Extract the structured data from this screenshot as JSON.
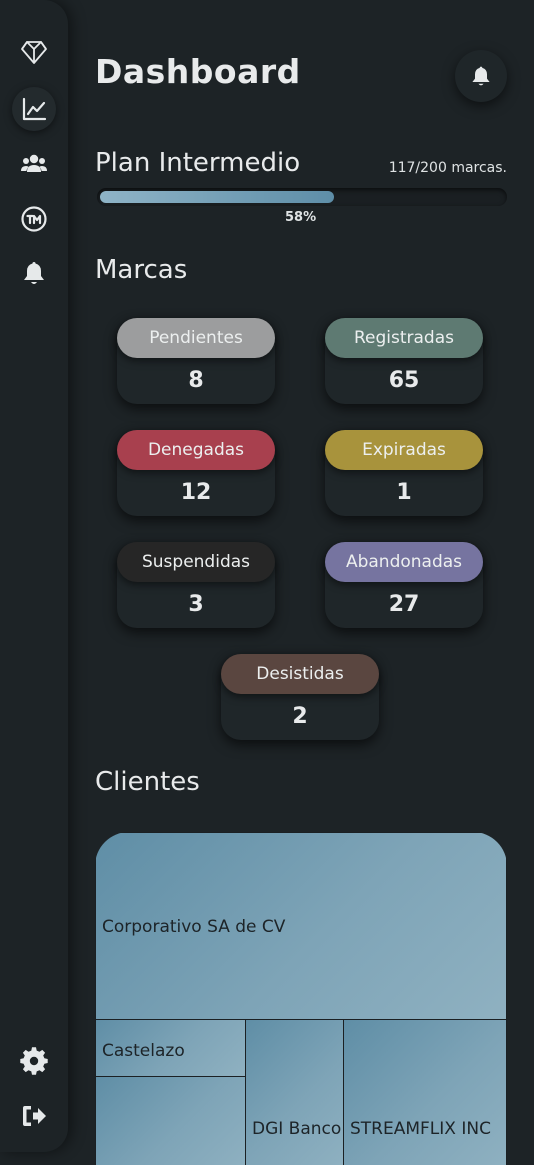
{
  "sidebar": {
    "items": [
      {
        "icon": "diamond-logo-icon"
      },
      {
        "icon": "chart-line-icon",
        "active": true
      },
      {
        "icon": "users-icon"
      },
      {
        "icon": "trademark-icon"
      },
      {
        "icon": "bell-icon"
      }
    ],
    "bottom": [
      {
        "icon": "gear-icon"
      },
      {
        "icon": "logout-icon"
      }
    ]
  },
  "header": {
    "title": "Dashboard",
    "bell_icon": "bell-icon"
  },
  "plan": {
    "name": "Plan Intermedio",
    "count": "117/200 marcas.",
    "progress": 0.58,
    "percent_label": "58%"
  },
  "marcas": {
    "title": "Marcas",
    "cards": [
      {
        "label": "Pendientes",
        "value": "8",
        "color": "#9c9d9e"
      },
      {
        "label": "Registradas",
        "value": "65",
        "color": "#5e7a72"
      },
      {
        "label": "Denegadas",
        "value": "12",
        "color": "#a8404e"
      },
      {
        "label": "Expiradas",
        "value": "1",
        "color": "#a8933c"
      },
      {
        "label": "Suspendidas",
        "value": "3",
        "color": "#262626"
      },
      {
        "label": "Abandonadas",
        "value": "27",
        "color": "#7674a0"
      },
      {
        "label": "Desistidas",
        "value": "2",
        "color": "#5a4640"
      }
    ]
  },
  "clientes": {
    "title": "Clientes",
    "treemap": [
      {
        "label": "Corporativo SA de CV"
      },
      {
        "label": "Castelazo"
      },
      {
        "label": ""
      },
      {
        "label": "DGI Banco"
      },
      {
        "label": "STREAMFLIX INC"
      }
    ]
  }
}
